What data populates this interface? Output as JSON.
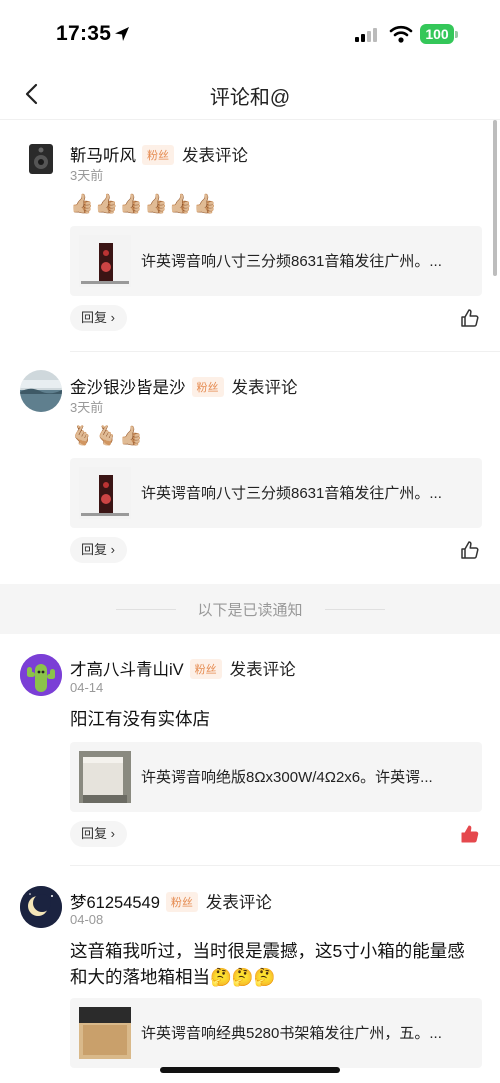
{
  "status_bar": {
    "time": "17:35",
    "battery": "100"
  },
  "nav": {
    "title": "评论和@"
  },
  "read_separator": "以下是已读通知",
  "notifications": [
    {
      "username": "靳马听风",
      "badge": "粉丝",
      "action": "发表评论",
      "time": "3天前",
      "content": "👍🏼👍🏼👍🏼👍🏼👍🏼👍🏼",
      "card_text": "许英谔音响八寸三分频8631音箱发往广州。...",
      "reply_label": "回复 ›",
      "liked": false
    },
    {
      "username": "金沙银沙皆是沙",
      "badge": "粉丝",
      "action": "发表评论",
      "time": "3天前",
      "content": "🫰🏼🫰🏼👍🏼",
      "card_text": "许英谔音响八寸三分频8631音箱发往广州。...",
      "reply_label": "回复 ›",
      "liked": false
    },
    {
      "username": "才高八斗青山iV",
      "badge": "粉丝",
      "action": "发表评论",
      "time": "04-14",
      "content": "阳江有没有实体店",
      "card_text": "许英谔音响绝版8Ωx300W/4Ω2x6。许英谔...",
      "reply_label": "回复 ›",
      "liked": true
    },
    {
      "username": "梦61254549",
      "badge": "粉丝",
      "action": "发表评论",
      "time": "04-08",
      "content": "这音箱我听过，当时很是震撼，这5寸小箱的能量感和大的落地箱相当🤔🤔🤔",
      "card_text": "许英谔音响经典5280书架箱发往广州，五。...",
      "reply_label": "回复 ›",
      "liked": false
    }
  ],
  "colors": {
    "accent": "#e5484d",
    "badge_text": "#e58a4f",
    "badge_bg": "#fdf0e7",
    "battery": "#34c759"
  }
}
